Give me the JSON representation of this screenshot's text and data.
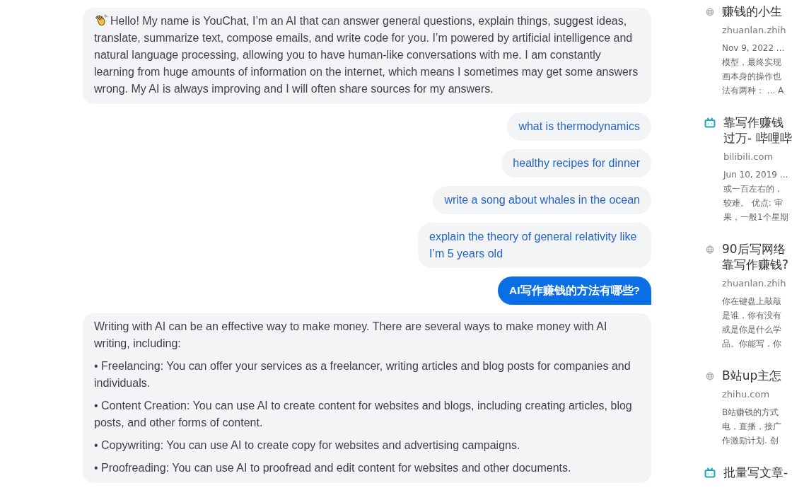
{
  "chat": {
    "messages": [
      {
        "kind": "greeting",
        "paragraphs": [
          "Hello! My name is YouChat, I’m an AI that can answer general questions, explain things, suggest ideas, translate, summarize text, compose emails, and write code for you. I’m powered by artificial intelligence and natural language processing, allowing you to have human-like conversations with me. I am constantly learning from huge amounts of information on the internet, which means I sometimes may get some answers wrong. My AI is always improving and I will often share sources for my answers."
        ]
      },
      {
        "kind": "suggestion",
        "text": "what is thermodynamics"
      },
      {
        "kind": "suggestion",
        "text": "healthy recipes for dinner"
      },
      {
        "kind": "suggestion",
        "text": "write a song about whales in the ocean"
      },
      {
        "kind": "suggestion",
        "text": "explain the theory of general relativity like I’m 5 years old"
      },
      {
        "kind": "question",
        "text": "AI写作赚钱的方法有哪些?"
      },
      {
        "kind": "answer",
        "paragraphs": [
          "Writing with AI can be an effective way to make money. There are several ways to make money with AI writing, including:",
          "• Freelancing: You can offer your services as a freelancer, writing articles and blog posts for companies and individuals.",
          "• Content Creation: You can use AI to create content for websites and blogs, including creating articles, blog posts, and other forms of content.",
          "• Copywriting: You can use AI to create copy for websites and advertising campaigns.",
          "• Proofreading: You can use AI to proofread and edit content for websites and other documents."
        ]
      }
    ]
  },
  "sources": [
    {
      "kind": "web",
      "title": [
        "赚钱的小生"
      ],
      "site": "zhuanlan.zhih",
      "snippet": [
        "Nov 9, 2022 ...",
        "模型，最终实现",
        "画本身的操作也",
        "法有两种： ... A"
      ]
    },
    {
      "kind": "video",
      "title": [
        "靠写作赚钱",
        "过万- 哔哩哔"
      ],
      "site": "bilibili.com",
      "snippet": [
        "Jun 10, 2019 ...",
        "或一百左右的，",
        "较难。 优点: 审",
        "果，一般1个星期"
      ]
    },
    {
      "kind": "web",
      "title": [
        "90后写网络",
        "靠写作赚钱?"
      ],
      "site": "zhuanlan.zhih",
      "snippet": [
        "你在键盘上敲敲",
        "是谁，你有没有",
        "或是你是什么学",
        "品。你能写，你"
      ]
    },
    {
      "kind": "web",
      "title": [
        "B站up主怎"
      ],
      "site": "zhihu.com",
      "snippet": [
        "B站赚钱的方式",
        "电，直播，接广",
        "作激励计划. 创"
      ]
    },
    {
      "kind": "video",
      "title": [
        "批量写文章-"
      ]
    }
  ]
}
